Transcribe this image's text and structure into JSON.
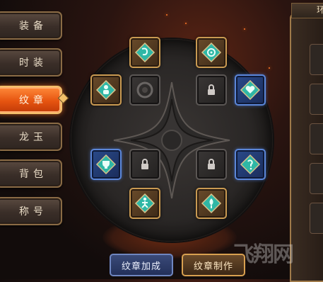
{
  "tabs": [
    {
      "label": "装备",
      "active": false
    },
    {
      "label": "时装",
      "active": false
    },
    {
      "label": "纹章",
      "active": true
    },
    {
      "label": "龙玉",
      "active": false
    },
    {
      "label": "背包",
      "active": false
    },
    {
      "label": "称号",
      "active": false
    }
  ],
  "buttons": {
    "bonus_label": "纹章加成",
    "craft_label": "纹章制作"
  },
  "right_panel": {
    "title": "环"
  },
  "watermark": "飞翔网",
  "slots": [
    {
      "name": "slot-top-left",
      "frame": "gold",
      "icon": "rune-swirl-icon"
    },
    {
      "name": "slot-top-right",
      "frame": "gold",
      "icon": "rune-spiral-icon"
    },
    {
      "name": "slot-upper-left",
      "frame": "gold",
      "icon": "rune-person-icon"
    },
    {
      "name": "slot-upper-inner-left",
      "frame": "dark",
      "icon": "empty-socket-icon"
    },
    {
      "name": "slot-upper-inner-right",
      "frame": "dark",
      "icon": "lock-icon"
    },
    {
      "name": "slot-upper-right",
      "frame": "blue",
      "icon": "rune-heart-icon"
    },
    {
      "name": "slot-lower-left",
      "frame": "blue",
      "icon": "rune-trophy-icon"
    },
    {
      "name": "slot-lower-inner-left",
      "frame": "dark",
      "icon": "lock-icon"
    },
    {
      "name": "slot-lower-inner-right",
      "frame": "dark",
      "icon": "lock-icon"
    },
    {
      "name": "slot-lower-right",
      "frame": "blue",
      "icon": "rune-hook-icon"
    },
    {
      "name": "slot-bottom-left",
      "frame": "gold",
      "icon": "rune-runner-icon"
    },
    {
      "name": "slot-bottom-right",
      "frame": "gold",
      "icon": "rune-flame-icon"
    }
  ],
  "colors": {
    "accent": "#e65410",
    "gem_teal": "#3ec3b0",
    "blue_frame": "#5b86d8",
    "gold_frame": "#c99a52"
  }
}
